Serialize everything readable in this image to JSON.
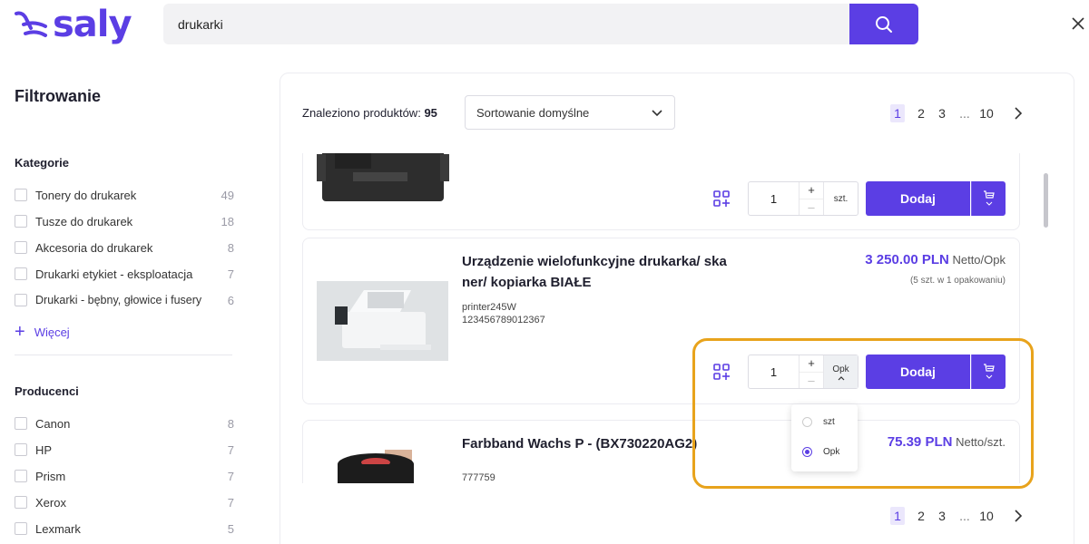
{
  "header": {
    "logo_text": "saly",
    "search_value": "drukarki",
    "search_button_icon": "search-icon",
    "close_icon": "close-icon"
  },
  "sidebar": {
    "title": "Filtrowanie",
    "categories": {
      "title": "Kategorie",
      "items": [
        {
          "label": "Tonery do drukarek",
          "count": "49"
        },
        {
          "label": "Tusze do drukarek",
          "count": "18"
        },
        {
          "label": "Akcesoria do drukarek",
          "count": "8"
        },
        {
          "label": "Drukarki etykiet - eksploatacja",
          "count": "7"
        },
        {
          "label": "Drukarki - bębny, głowice i fusery",
          "count": "6"
        }
      ],
      "more_label": "Więcej"
    },
    "producers": {
      "title": "Producenci",
      "items": [
        {
          "label": "Canon",
          "count": "8"
        },
        {
          "label": "HP",
          "count": "7"
        },
        {
          "label": "Prism",
          "count": "7"
        },
        {
          "label": "Xerox",
          "count": "7"
        },
        {
          "label": "Lexmark",
          "count": "5"
        }
      ]
    }
  },
  "main": {
    "found_label": "Znaleziono produktów:",
    "found_count": "95",
    "sort_value": "Sortowanie domyślne",
    "pagination": {
      "pages": [
        "1",
        "2",
        "3"
      ],
      "ellipsis": "...",
      "last": "10",
      "active": "1"
    },
    "products": [
      {
        "title": "",
        "qty": "1",
        "unit": "szt.",
        "add_label": "Dodaj"
      },
      {
        "title": "Urządzenie wielofunkcyjne drukarka/ skaner/ kopiarka BIAŁE",
        "title_line1": "Urządzenie wielofunkcyjne drukarka/ ska",
        "title_line2": "ner/ kopiarka BIAŁE",
        "sku": "printer245W",
        "ean": "123456789012367",
        "price": "3 250.00 PLN",
        "price_unit": "Netto/Opk",
        "pack_info": "(5 szt. w 1 opakowaniu)",
        "qty": "1",
        "unit": "Opk",
        "add_label": "Dodaj"
      },
      {
        "title": "Farbband Wachs P - (BX730220AG2)",
        "sku": "777759",
        "price": "75.39 PLN",
        "price_unit": "Netto/szt."
      }
    ],
    "unit_dropdown": {
      "options": [
        "szt",
        "Opk"
      ],
      "selected": "Opk"
    }
  },
  "colors": {
    "brand": "#5b3ee4",
    "highlight": "#e8a31c"
  }
}
